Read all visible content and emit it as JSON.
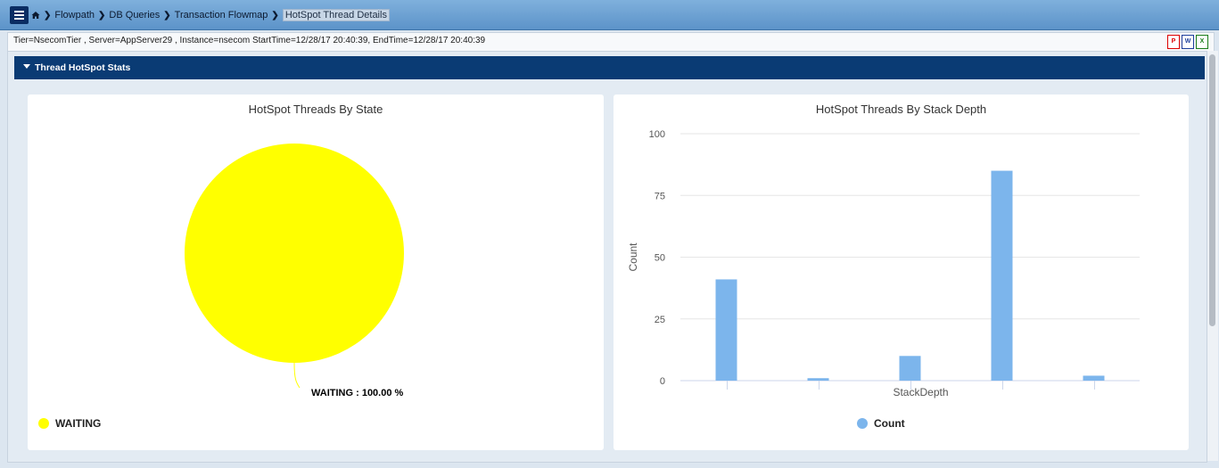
{
  "breadcrumb": {
    "items": [
      "Flowpath",
      "DB Queries",
      "Transaction Flowmap"
    ],
    "current": "HotSpot Thread Details"
  },
  "info": {
    "text": "Tier=NsecomTier , Server=AppServer29 , Instance=nsecom StartTime=12/28/17 20:40:39, EndTime=12/28/17 20:40:39"
  },
  "export_icons": [
    "pdf-icon",
    "word-icon",
    "excel-icon"
  ],
  "panel": {
    "title": "Thread HotSpot Stats"
  },
  "colors": {
    "pie": "#ffff00",
    "bar": "#7cb5ec",
    "header": "#0a3b74"
  },
  "chart_data": [
    {
      "type": "pie",
      "title": "HotSpot Threads By State",
      "slices": [
        {
          "name": "WAITING",
          "value": 100.0
        }
      ],
      "data_label": "WAITING : 100.00 %",
      "legend": [
        "WAITING"
      ]
    },
    {
      "type": "bar",
      "title": "HotSpot Threads By Stack Depth",
      "xlabel": "StackDepth",
      "ylabel": "Count",
      "ylim": [
        0,
        100
      ],
      "yticks": [
        0,
        25,
        50,
        75,
        100
      ],
      "series": [
        {
          "name": "Count",
          "values": [
            41,
            1,
            10,
            85,
            2
          ]
        }
      ],
      "legend": [
        "Count"
      ]
    }
  ]
}
